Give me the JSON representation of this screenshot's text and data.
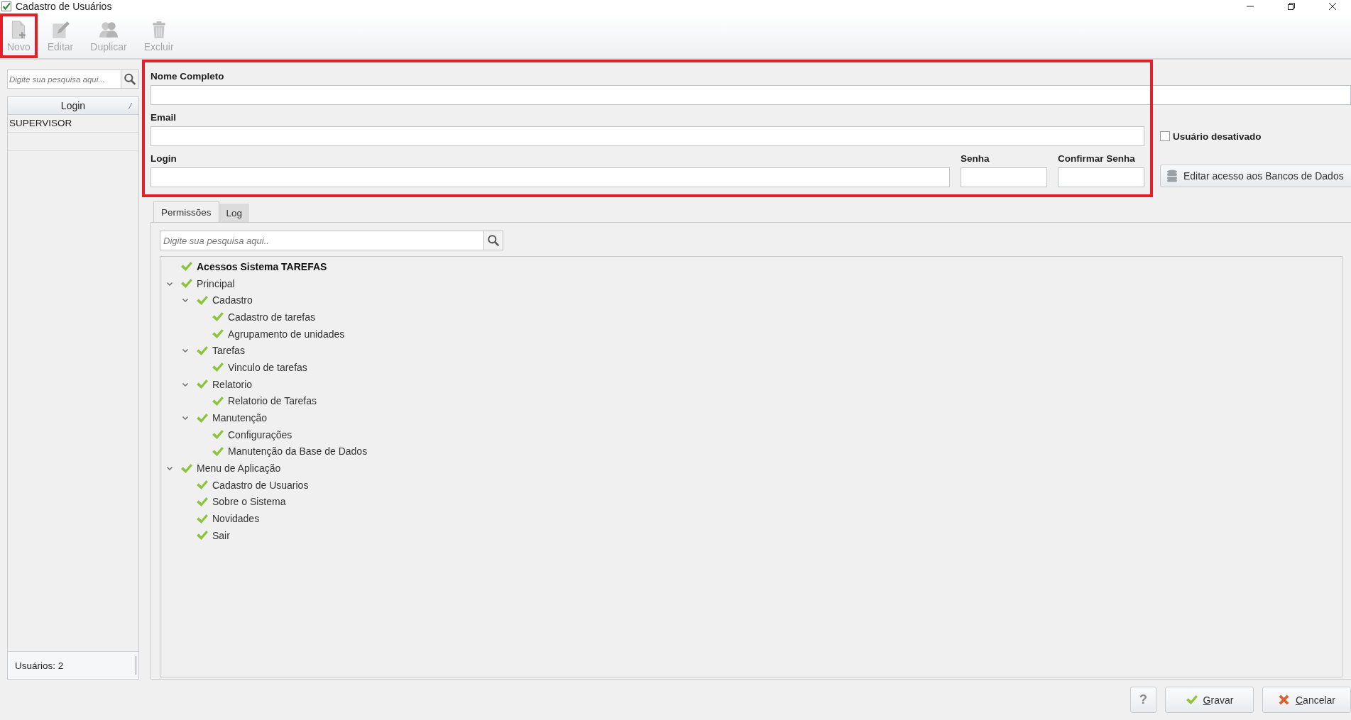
{
  "window": {
    "title": "Cadastro de Usuários"
  },
  "toolbar": [
    {
      "label": "Novo",
      "kind": "new",
      "disabled": true,
      "highlighted": true
    },
    {
      "label": "Editar",
      "kind": "edit",
      "disabled": true,
      "highlighted": false
    },
    {
      "label": "Duplicar",
      "kind": "duplicate",
      "disabled": true,
      "highlighted": false
    },
    {
      "label": "Excluir",
      "kind": "delete",
      "disabled": true,
      "highlighted": false
    }
  ],
  "user_list": {
    "search_placeholder": "Digite sua pesquisa aqui...",
    "column": "Login",
    "sort_mark": "/",
    "rows": [
      {
        "login": "SUPERVISOR",
        "selected": false
      }
    ],
    "status": "Usuários: 2"
  },
  "form": {
    "highlighted": true,
    "fields": [
      {
        "label": "Nome Completo"
      },
      {
        "label": "Email"
      },
      {
        "label": "Login"
      },
      {
        "label": "Senha"
      },
      {
        "label": "Confirmar Senha"
      }
    ]
  },
  "disabled_checkbox": {
    "label": "Usuário desativado",
    "checked": false
  },
  "db_access_button": {
    "label": "Editar acesso aos Bancos de Dados"
  },
  "tabs": [
    {
      "label": "Permissões",
      "selected": true
    },
    {
      "label": "Log",
      "selected": false
    }
  ],
  "permissions": {
    "search_placeholder": "Digite sua pesquisa aqui..",
    "tree": [
      {
        "label": "Acessos Sistema TAREFAS",
        "kind": "header",
        "checked": true
      },
      {
        "label": "Principal",
        "kind": "item",
        "checked": true,
        "expanded": true,
        "children": [
          {
            "label": "Cadastro",
            "kind": "item",
            "checked": true,
            "expanded": true,
            "children": [
              {
                "label": "Cadastro de tarefas",
                "kind": "item",
                "checked": true
              },
              {
                "label": "Agrupamento de unidades",
                "kind": "item",
                "checked": true
              }
            ]
          },
          {
            "label": "Tarefas",
            "kind": "item",
            "checked": true,
            "expanded": true,
            "children": [
              {
                "label": "Vinculo de tarefas",
                "kind": "item",
                "checked": true
              }
            ]
          },
          {
            "label": "Relatorio",
            "kind": "item",
            "checked": true,
            "expanded": true,
            "children": [
              {
                "label": "Relatorio de Tarefas",
                "kind": "item",
                "checked": true
              }
            ]
          },
          {
            "label": "Manutenção",
            "kind": "item",
            "checked": true,
            "expanded": true,
            "children": [
              {
                "label": "Configurações",
                "kind": "item",
                "checked": true
              },
              {
                "label": "Manutenção da Base de Dados",
                "kind": "item",
                "checked": true
              }
            ]
          }
        ]
      },
      {
        "label": "Menu de Aplicação",
        "kind": "item",
        "checked": true,
        "expanded": true,
        "children": [
          {
            "label": "Cadastro de Usuarios",
            "kind": "item",
            "checked": true
          },
          {
            "label": "Sobre o Sistema",
            "kind": "item",
            "checked": true
          },
          {
            "label": "Novidades",
            "kind": "item",
            "checked": true
          },
          {
            "label": "Sair",
            "kind": "item",
            "checked": true
          }
        ]
      }
    ]
  },
  "footer": {
    "help_button": "?",
    "buttons": [
      {
        "label": "Gravar",
        "kind": "confirm"
      },
      {
        "label": "Cancelar",
        "kind": "cancel"
      }
    ]
  }
}
